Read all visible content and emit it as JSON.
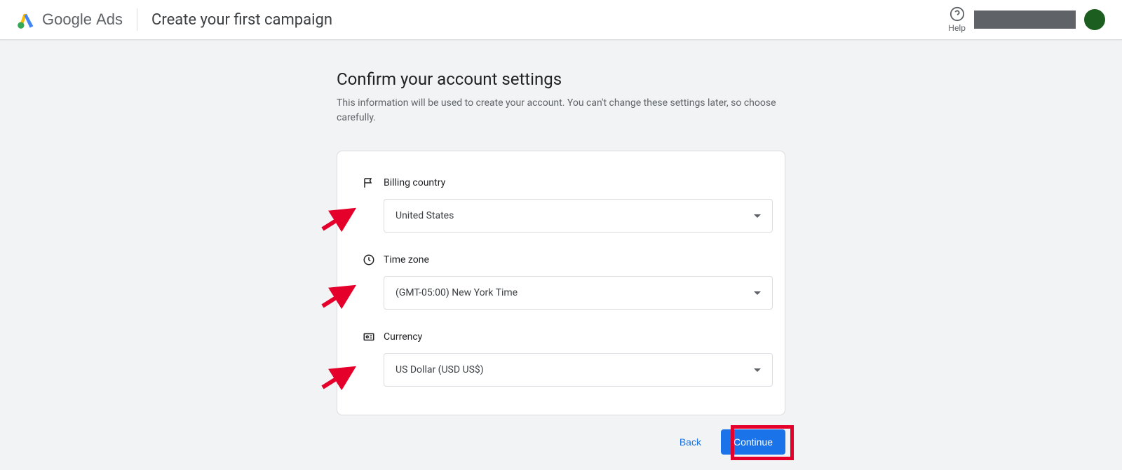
{
  "header": {
    "logo_text_1": "Google",
    "logo_text_2": "Ads",
    "title": "Create your first campaign",
    "help_label": "Help"
  },
  "main": {
    "title": "Confirm your account settings",
    "subtitle": "This information will be used to create your account. You can't change these settings later, so choose carefully."
  },
  "form": {
    "billing_country": {
      "label": "Billing country",
      "value": "United States"
    },
    "time_zone": {
      "label": "Time zone",
      "value": "(GMT-05:00) New York Time"
    },
    "currency": {
      "label": "Currency",
      "value": "US Dollar (USD US$)"
    }
  },
  "actions": {
    "back": "Back",
    "continue": "Continue"
  }
}
